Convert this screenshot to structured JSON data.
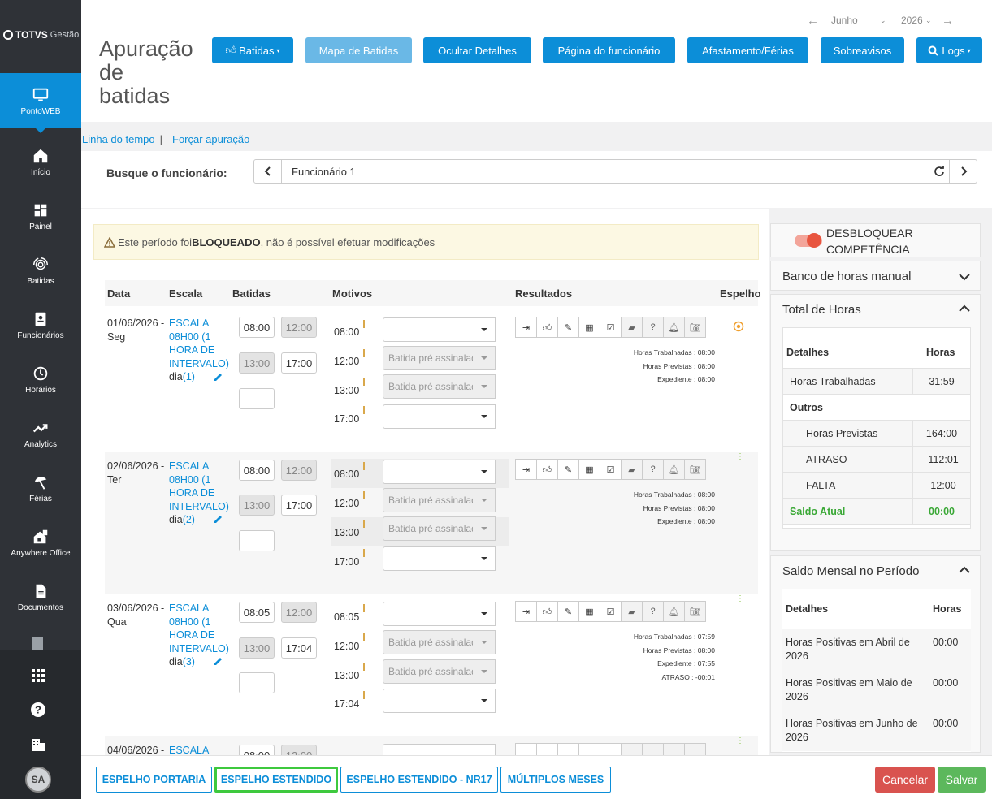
{
  "sidebar": {
    "logo_brand": "TOTVS",
    "logo_product": "Gestão",
    "items": [
      {
        "label": "PontoWEB",
        "icon": "monitor-icon"
      },
      {
        "label": "Início",
        "icon": "home-icon"
      },
      {
        "label": "Painel",
        "icon": "dashboard-icon"
      },
      {
        "label": "Batidas",
        "icon": "fingerprint-icon"
      },
      {
        "label": "Funcionários",
        "icon": "badge-icon"
      },
      {
        "label": "Horários",
        "icon": "clock-icon"
      },
      {
        "label": "Analytics",
        "icon": "trend-icon"
      },
      {
        "label": "Férias",
        "icon": "beach-icon"
      },
      {
        "label": "Anywhere Office",
        "icon": "home-office-icon"
      },
      {
        "label": "Documentos",
        "icon": "document-icon"
      }
    ],
    "avatar": "SA"
  },
  "header": {
    "title_lines": [
      "Apuração",
      "de",
      "batidas"
    ],
    "month": "Junho",
    "year": "2026",
    "buttons": {
      "batidas": "Batidas",
      "mapa": "Mapa de Batidas",
      "ocultar": "Ocultar Detalhes",
      "pagina": "Página do funcionário",
      "afastamento": "Afastamento/Férias",
      "sobreavisos": "Sobreavisos",
      "logs": "Logs"
    }
  },
  "links": {
    "timeline": "Linha do tempo",
    "sep": "|",
    "forcar": "Forçar apuração"
  },
  "search": {
    "label": "Busque o funcionário:",
    "value": "Funcionário 1"
  },
  "warning": {
    "pre": "Este período foi ",
    "bold": "BLOQUEADO",
    "post": ", não é possível efetuar modificações"
  },
  "table": {
    "headers": {
      "data": "Data",
      "escala": "Escala",
      "batidas": "Batidas",
      "motivos": "Motivos",
      "resultados": "Resultados",
      "espelho": "Espelho"
    },
    "placeholder": "Batida pré assinalada",
    "rows": [
      {
        "date": "01/06/2026 -",
        "weekday": "Seg",
        "escala": [
          "ESCALA",
          "08H00 (1",
          "HORA DE",
          "INTERVALO)"
        ],
        "dia_label": "dia",
        "dia_num": "(1)",
        "batidas": [
          "08:00",
          "12:00",
          "13:00",
          "17:00"
        ],
        "motivo_times": [
          "08:00",
          "12:00",
          "13:00",
          "17:00"
        ],
        "results": [
          "Horas Trabalhadas : 08:00",
          "Horas Previstas : 08:00",
          "Expediente : 08:00"
        ]
      },
      {
        "date": "02/06/2026 -",
        "weekday": "Ter",
        "escala": [
          "ESCALA",
          "08H00 (1",
          "HORA DE",
          "INTERVALO)"
        ],
        "dia_label": "dia",
        "dia_num": "(2)",
        "batidas": [
          "08:00",
          "12:00",
          "13:00",
          "17:00"
        ],
        "motivo_times": [
          "08:00",
          "12:00",
          "13:00",
          "17:00"
        ],
        "results": [
          "Horas Trabalhadas : 08:00",
          "Horas Previstas : 08:00",
          "Expediente : 08:00"
        ]
      },
      {
        "date": "03/06/2026 -",
        "weekday": "Qua",
        "escala": [
          "ESCALA",
          "08H00 (1",
          "HORA DE",
          "INTERVALO)"
        ],
        "dia_label": "dia",
        "dia_num": "(3)",
        "batidas": [
          "08:05",
          "12:00",
          "13:00",
          "17:04"
        ],
        "motivo_times": [
          "08:05",
          "12:00",
          "13:00",
          "17:04"
        ],
        "results": [
          "Horas Trabalhadas : 07:59",
          "Horas Previstas : 08:00",
          "Expediente : 07:55",
          "ATRASO : -00:01"
        ]
      },
      {
        "date": "04/06/2026 -",
        "weekday": "",
        "escala": [
          "ESCALA"
        ],
        "dia_label": "",
        "dia_num": "",
        "batidas": [
          "08:00",
          "12:00"
        ],
        "motivo_times": [],
        "results": []
      }
    ]
  },
  "right": {
    "toggle_label": "DESBLOQUEAR COMPETÊNCIA",
    "banco": "Banco de horas manual",
    "total": {
      "title": "Total de Horas",
      "col1": "Detalhes",
      "col2": "Horas",
      "rows": [
        {
          "label": "Horas Trabalhadas",
          "value": "31:59"
        },
        {
          "label": "Outros",
          "value": ""
        },
        {
          "label": "Horas Previstas",
          "value": "164:00"
        },
        {
          "label": "ATRASO",
          "value": "-112:01"
        },
        {
          "label": "FALTA",
          "value": "-12:00"
        },
        {
          "label": "Saldo Atual",
          "value": "00:00"
        }
      ]
    },
    "saldo": {
      "title": "Saldo Mensal no Período",
      "col1": "Detalhes",
      "col2": "Horas",
      "rows": [
        {
          "label": "Horas Positivas em Abril de 2026",
          "value": "00:00"
        },
        {
          "label": "Horas Positivas em Maio de 2026",
          "value": "00:00"
        },
        {
          "label": "Horas Positivas em Junho de 2026",
          "value": "00:00"
        }
      ]
    }
  },
  "footer": {
    "espelho_portaria": "ESPELHO PORTARIA",
    "espelho_estendido": "ESPELHO ESTENDIDO",
    "espelho_nr17": "ESPELHO ESTENDIDO - NR17",
    "multiplos": "MÚLTIPLOS MESES",
    "cancelar": "Cancelar",
    "salvar": "Salvar"
  },
  "colors": {
    "primary": "#0c8ed8",
    "success": "#5cb85c",
    "danger": "#d9534f",
    "warning_bg": "#fcf8e3",
    "positive_text": "#3aa836",
    "sidebar": "#2f3237"
  }
}
